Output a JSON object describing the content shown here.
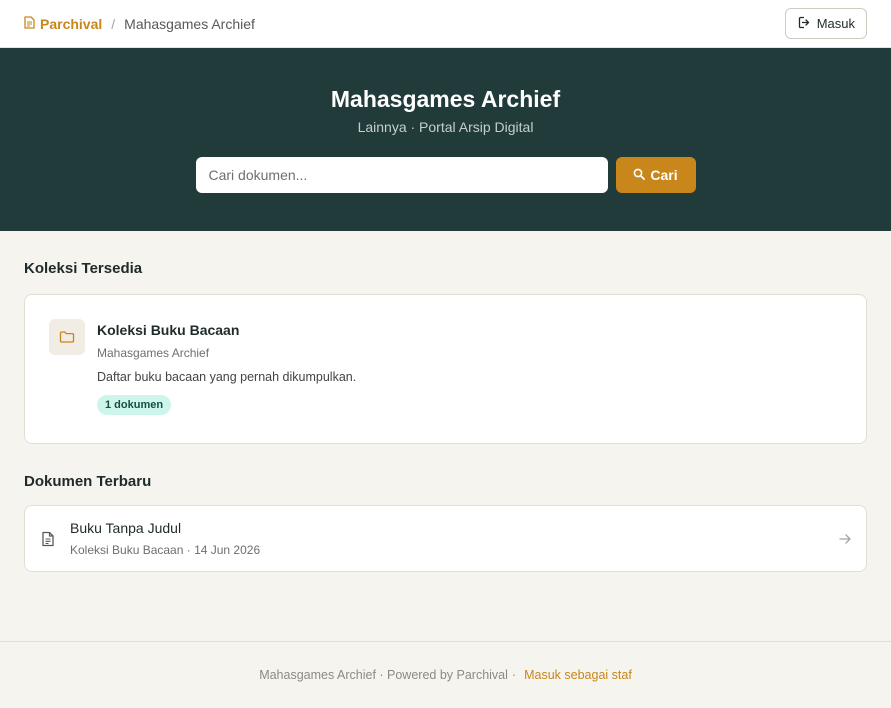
{
  "topbar": {
    "home_label": "Parchival",
    "separator": "/",
    "current_label": "Mahasgames Archief",
    "login_label": "Masuk"
  },
  "hero": {
    "title": "Mahasgames Archief",
    "subtitle": "Lainnya · Portal Arsip Digital",
    "search_placeholder": "Cari dokumen...",
    "search_button": "Cari"
  },
  "collections": {
    "heading": "Koleksi Tersedia",
    "items": [
      {
        "title": "Koleksi Buku Bacaan",
        "owner": "Mahasgames Archief",
        "description": "Daftar buku bacaan yang pernah dikumpulkan.",
        "badge": "1 dokumen",
        "icon": "folder-icon"
      }
    ]
  },
  "recent": {
    "heading": "Dokumen Terbaru",
    "items": [
      {
        "title": "Buku Tanpa Judul",
        "meta": "Koleksi Buku Bacaan · 14 Jun 2026",
        "icon": "document-icon"
      }
    ]
  },
  "footer": {
    "text": "Mahasgames Archief · Powered by Parchival",
    "separator": "·",
    "staff_link": "Masuk sebagai staf"
  },
  "colors": {
    "accent": "#c9861a",
    "hero_bg": "#213b3b",
    "page_bg": "#f5f4ef",
    "badge_bg": "#cdf5ec"
  }
}
